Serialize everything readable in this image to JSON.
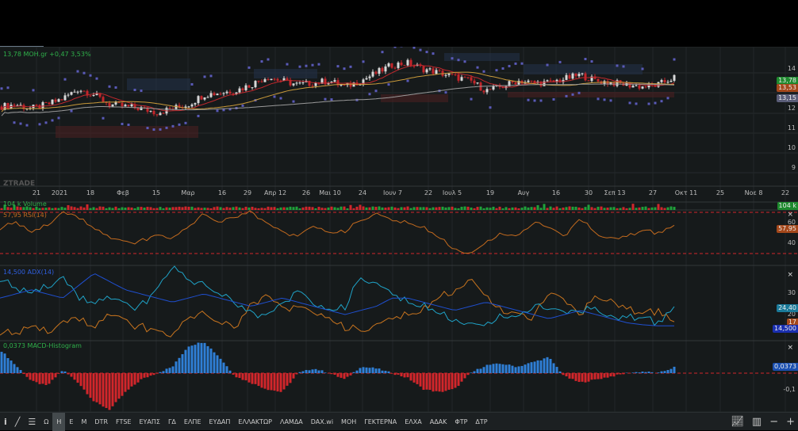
{
  "header": {
    "quote": "13,78 ΜΟΗ.gr +0,47 3,53%"
  },
  "watermark": "ZTRADE",
  "price_axis": {
    "ticks": [
      "14",
      "12",
      "11",
      "10",
      "9"
    ],
    "tags": [
      {
        "text": "13,78",
        "color": "#1e8a2e"
      },
      {
        "text": "13,53",
        "color": "#a4471a"
      },
      {
        "text": "13,15",
        "color": "#5a5d78"
      }
    ]
  },
  "time_axis": [
    "21",
    "2021",
    "18",
    "Φεβ",
    "15",
    "Μαρ",
    "16",
    "29",
    "Απρ 12",
    "26",
    "Μαι 10",
    "24",
    "Ιουν 7",
    "22",
    "Ιουλ 5",
    "19",
    "Αυγ",
    "16",
    "30",
    "Σεπ 13",
    "27",
    "Οκτ 11",
    "25",
    "Νοε 8",
    "22"
  ],
  "volume": {
    "label": "104 k Volume",
    "tag": "104 k"
  },
  "rsi": {
    "label": "57,95 RSI(14)",
    "ticks": [
      "60",
      "40"
    ],
    "tag": "57,95",
    "close": "×"
  },
  "adx": {
    "label": "14,500 ADX(14)",
    "ticks": [
      "30",
      "20"
    ],
    "tags": [
      "24,40",
      "17",
      "14,500"
    ],
    "close": "×"
  },
  "macd": {
    "label": "0,0373 MACD-Histogram",
    "ticks": [
      "-0,1"
    ],
    "tag": "0,0373",
    "close": "×"
  },
  "toolbar": {
    "items": [
      "Ω",
      "Η",
      "Ε",
      "Μ",
      "DTR",
      "FTSE",
      "ΕΥΑΠΣ",
      "ΓΔ",
      "ΕΛΠΕ",
      "ΕΥΔΑΠ",
      "ΕΛΛΑΚΤΩΡ",
      "ΛΑΜΔΑ",
      "DAX.wi",
      "ΜΟΗ",
      "ΓΕΚΤΕΡΝΑ",
      "ΕΛΧΑ",
      "ΑΔΑΚ",
      "ΦΤΡ",
      "ΔΤΡ"
    ],
    "active": "Η",
    "zoom_out": "−",
    "zoom_in": "+"
  },
  "colors": {
    "up": "#d8d8d8",
    "down": "#c4262b",
    "ma_fast": "#c0282d",
    "ma_slow": "#c99a3a",
    "ma_long": "#9a9a9a",
    "rsi": "#c36a1e",
    "adx": "#1f4fd0",
    "di_plus": "#1fa3c8",
    "di_minus": "#c8741e",
    "macd_pos": "#2f7fd6",
    "macd_neg": "#d2262b",
    "sar": "#5a5ab8"
  },
  "chart_data": {
    "type": "line",
    "symbol": "ΜΟΗ.gr",
    "price_close": [
      12.3,
      12.4,
      12.2,
      12.4,
      12.7,
      13.2,
      12.9,
      12.4,
      12.3,
      12.2,
      12.0,
      12.2,
      12.4,
      12.9,
      13.0,
      13.1,
      13.4,
      13.8,
      13.6,
      13.4,
      13.5,
      13.6,
      13.3,
      13.6,
      14.0,
      14.4,
      14.5,
      14.2,
      14.0,
      13.8,
      13.6,
      13.1,
      13.3,
      13.6,
      13.5,
      13.5,
      13.7,
      13.9,
      13.6,
      13.5,
      13.4,
      13.3,
      13.4,
      13.78
    ],
    "rsi": [
      55,
      60,
      50,
      58,
      70,
      65,
      55,
      45,
      40,
      42,
      48,
      45,
      55,
      68,
      60,
      66,
      70,
      58,
      52,
      45,
      58,
      50,
      52,
      62,
      68,
      62,
      60,
      55,
      45,
      35,
      28,
      42,
      50,
      46,
      60,
      55,
      45,
      65,
      50,
      44,
      48,
      52,
      50,
      57.95
    ],
    "adx": [
      28,
      30,
      32,
      30,
      28,
      34,
      40,
      36,
      32,
      30,
      28,
      26,
      28,
      30,
      28,
      26,
      24,
      26,
      28,
      26,
      24,
      22,
      20,
      22,
      24,
      28,
      28,
      26,
      24,
      22,
      24,
      26,
      24,
      22,
      20,
      18,
      20,
      22,
      20,
      18,
      16,
      15,
      14.5,
      14.5
    ],
    "di_plus": [
      38,
      32,
      30,
      34,
      38,
      28,
      26,
      28,
      24,
      24,
      32,
      44,
      36,
      34,
      30,
      26,
      20,
      18,
      26,
      30,
      26,
      22,
      24,
      38,
      34,
      30,
      26,
      24,
      20,
      18,
      14,
      16,
      20,
      18,
      24,
      22,
      20,
      22,
      24,
      18,
      20,
      18,
      16,
      24.4
    ],
    "di_minus": [
      12,
      10,
      14,
      12,
      16,
      18,
      14,
      20,
      16,
      14,
      12,
      10,
      18,
      20,
      16,
      14,
      24,
      28,
      24,
      22,
      22,
      18,
      14,
      12,
      14,
      18,
      20,
      22,
      28,
      32,
      36,
      30,
      22,
      20,
      18,
      30,
      26,
      20,
      30,
      26,
      24,
      20,
      22,
      17
    ],
    "macd_hist": [
      0.15,
      0.05,
      -0.05,
      -0.08,
      0.02,
      -0.06,
      -0.18,
      -0.23,
      -0.12,
      -0.04,
      0.0,
      0.04,
      0.17,
      0.2,
      0.1,
      -0.02,
      -0.06,
      -0.1,
      -0.12,
      0.0,
      0.03,
      0.0,
      -0.04,
      0.04,
      0.03,
      0.0,
      -0.03,
      -0.1,
      -0.12,
      -0.1,
      0.0,
      0.05,
      0.06,
      0.04,
      0.07,
      0.1,
      -0.02,
      -0.06,
      -0.04,
      -0.02,
      0.0,
      0.01,
      0.0,
      0.0373
    ],
    "rsi_levels": [
      70,
      30
    ],
    "ylim_price": [
      8.6,
      15.5
    ]
  }
}
